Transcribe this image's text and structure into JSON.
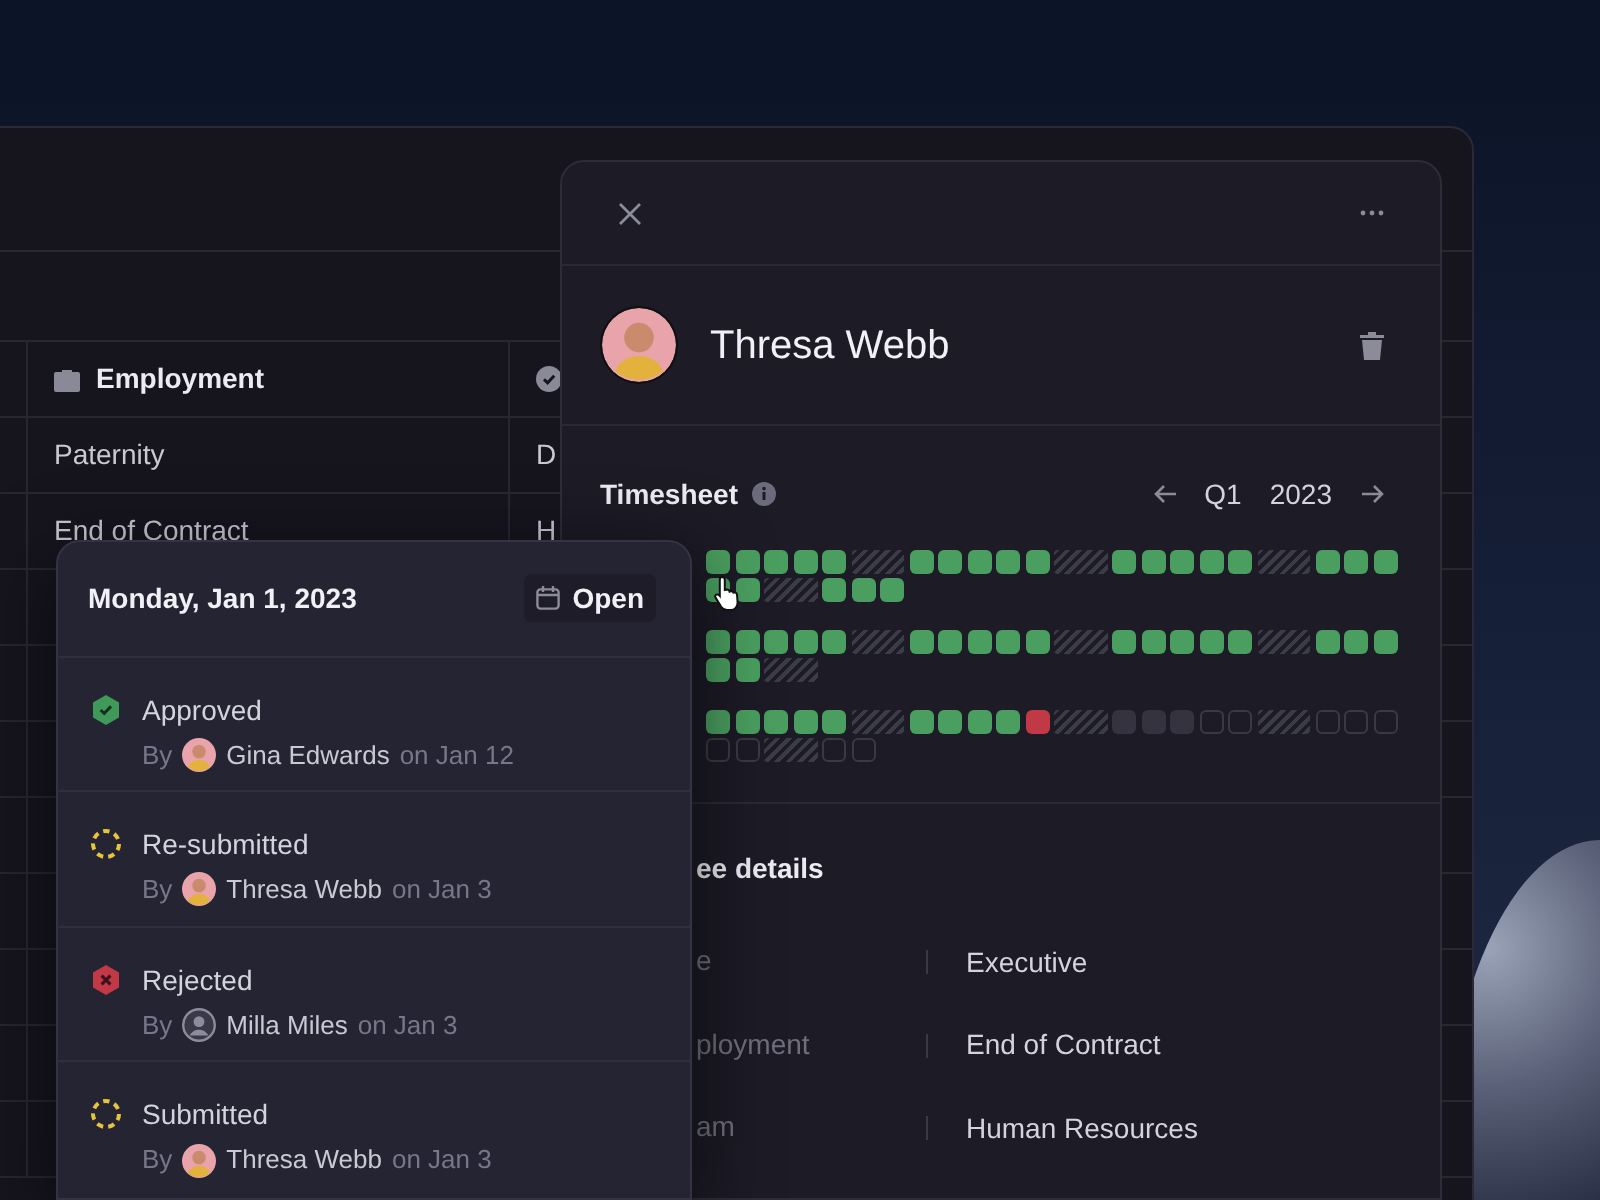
{
  "table": {
    "columns": [
      {
        "kind": "employment",
        "label": "Employment"
      },
      {
        "kind": "status"
      }
    ],
    "rows": [
      [
        "Paternity",
        "D"
      ],
      [
        "End of Contract",
        "H"
      ]
    ]
  },
  "panel": {
    "employee": {
      "name": "Thresa Webb"
    },
    "timesheet": {
      "title": "Timesheet",
      "quarter": "Q1",
      "year": "2023",
      "months": [
        [
          {
            "kind": "approved"
          },
          {
            "kind": "approved"
          },
          {
            "kind": "approved"
          },
          {
            "kind": "approved"
          },
          {
            "kind": "approved"
          },
          {
            "kind": "weekend"
          },
          {
            "kind": "approved"
          },
          {
            "kind": "approved"
          },
          {
            "kind": "approved"
          },
          {
            "kind": "approved"
          },
          {
            "kind": "approved"
          },
          {
            "kind": "weekend"
          },
          {
            "kind": "approved"
          },
          {
            "kind": "approved"
          },
          {
            "kind": "approved"
          },
          {
            "kind": "approved"
          },
          {
            "kind": "approved"
          },
          {
            "kind": "weekend"
          },
          {
            "kind": "approved"
          },
          {
            "kind": "approved"
          },
          {
            "kind": "approved"
          },
          {
            "kind": "approved"
          },
          {
            "kind": "approved"
          },
          {
            "kind": "weekend"
          },
          {
            "kind": "approved"
          },
          {
            "kind": "approved"
          },
          {
            "kind": "approved"
          }
        ],
        [
          {
            "kind": "approved"
          },
          {
            "kind": "approved"
          },
          {
            "kind": "approved"
          },
          {
            "kind": "approved"
          },
          {
            "kind": "approved"
          },
          {
            "kind": "weekend"
          },
          {
            "kind": "approved"
          },
          {
            "kind": "approved"
          },
          {
            "kind": "approved"
          },
          {
            "kind": "approved"
          },
          {
            "kind": "approved"
          },
          {
            "kind": "weekend"
          },
          {
            "kind": "approved"
          },
          {
            "kind": "approved"
          },
          {
            "kind": "approved"
          },
          {
            "kind": "approved"
          },
          {
            "kind": "approved"
          },
          {
            "kind": "weekend"
          },
          {
            "kind": "approved"
          },
          {
            "kind": "approved"
          },
          {
            "kind": "approved"
          },
          {
            "kind": "approved"
          },
          {
            "kind": "approved"
          },
          {
            "kind": "weekend"
          }
        ],
        [
          {
            "kind": "approved"
          },
          {
            "kind": "approved"
          },
          {
            "kind": "approved"
          },
          {
            "kind": "approved"
          },
          {
            "kind": "approved"
          },
          {
            "kind": "weekend"
          },
          {
            "kind": "approved"
          },
          {
            "kind": "approved"
          },
          {
            "kind": "approved"
          },
          {
            "kind": "approved"
          },
          {
            "kind": "rejected"
          },
          {
            "kind": "weekend"
          },
          {
            "kind": "pending"
          },
          {
            "kind": "pending"
          },
          {
            "kind": "pending"
          },
          {
            "kind": "empty"
          },
          {
            "kind": "empty"
          },
          {
            "kind": "weekend"
          },
          {
            "kind": "empty"
          },
          {
            "kind": "empty"
          },
          {
            "kind": "empty"
          },
          {
            "kind": "empty"
          },
          {
            "kind": "empty"
          },
          {
            "kind": "weekend"
          },
          {
            "kind": "empty"
          },
          {
            "kind": "empty"
          }
        ]
      ]
    },
    "details": {
      "title": "ee details",
      "rows": [
        {
          "label": "e",
          "value": "Executive"
        },
        {
          "label": "ployment",
          "value": "End of Contract"
        },
        {
          "label": "am",
          "value": "Human Resources"
        }
      ]
    }
  },
  "popover": {
    "date": "Monday, Jan 1, 2023",
    "open_button": "Open",
    "events": [
      {
        "kind": "approved",
        "status": "Approved",
        "by": "By",
        "person": "Gina Edwards",
        "avatar": {
          "kind": "photo"
        },
        "date": "on Jan 12"
      },
      {
        "kind": "submitted",
        "status": "Re-submitted",
        "by": "By",
        "person": "Thresa Webb",
        "avatar": {
          "kind": "photo"
        },
        "date": "on Jan 3"
      },
      {
        "kind": "rejected",
        "status": "Rejected",
        "by": "By",
        "person": "Milla Miles",
        "avatar": {
          "kind": "default"
        },
        "date": "on Jan 3"
      },
      {
        "kind": "submitted",
        "status": "Submitted",
        "by": "By",
        "person": "Thresa Webb",
        "avatar": {
          "kind": "photo"
        },
        "date": "on Jan 3"
      }
    ]
  }
}
